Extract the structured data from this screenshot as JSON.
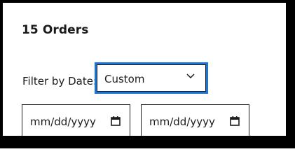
{
  "orders": {
    "title": "15 Orders"
  },
  "filter": {
    "label": "Filter by Date:",
    "selected": "Custom",
    "chevron_icon": "chevron-down-icon",
    "accent_color": "#1e73d6"
  },
  "date_range": {
    "start_placeholder": "mm/dd/yyyy",
    "end_placeholder": "mm/dd/yyyy",
    "calendar_icon": "calendar-icon"
  }
}
